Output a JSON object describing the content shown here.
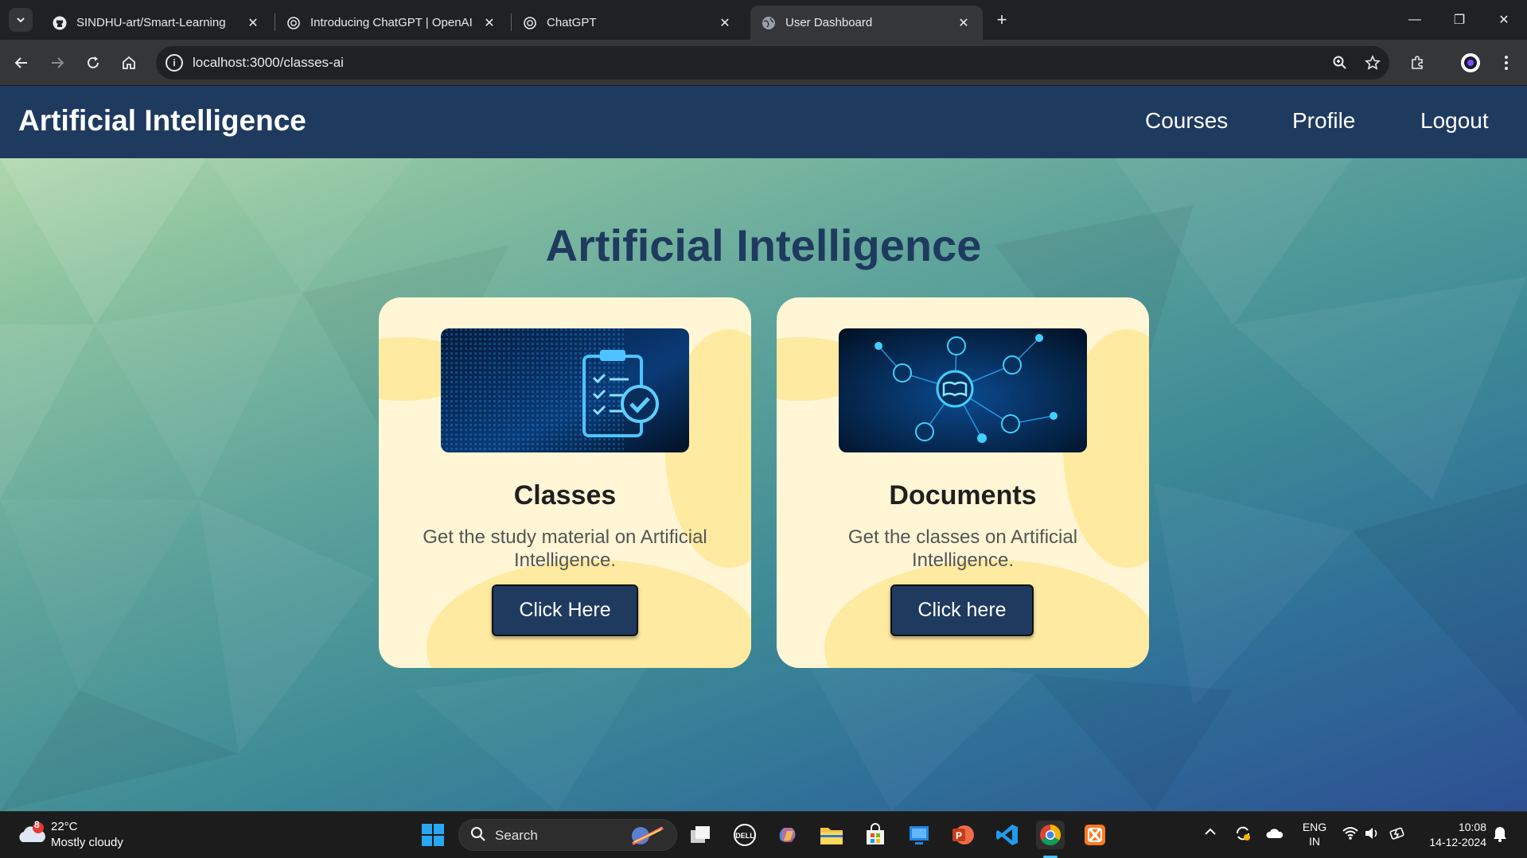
{
  "browser": {
    "tabs": [
      {
        "title": "SINDHU-art/Smart-Learning",
        "icon": "github-icon",
        "active": false
      },
      {
        "title": "Introducing ChatGPT | OpenAI",
        "icon": "openai-icon",
        "active": false
      },
      {
        "title": "ChatGPT",
        "icon": "openai-icon",
        "active": false
      },
      {
        "title": "User Dashboard",
        "icon": "globe-icon",
        "active": true
      }
    ],
    "url": "localhost:3000/classes-ai"
  },
  "app": {
    "brand": "Artificial Intelligence",
    "nav": {
      "courses": "Courses",
      "profile": "Profile",
      "logout": "Logout"
    },
    "heading": "Artificial Intelligence",
    "cards": [
      {
        "title": "Classes",
        "description": "Get the study material on Artificial Intelligence.",
        "button": "Click Here",
        "image": "clipboard-checklist-icon"
      },
      {
        "title": "Documents",
        "description": "Get the classes on Artificial Intelligence.",
        "button": "Click here",
        "image": "book-network-icon"
      }
    ],
    "colors": {
      "navbar": "#1f3a5f",
      "card": "#fff6d5",
      "button": "#1f3a5f"
    }
  },
  "taskbar": {
    "weather": {
      "temp": "22°C",
      "desc": "Mostly cloudy",
      "badge": "8"
    },
    "search": "Search",
    "lang": {
      "line1": "ENG",
      "line2": "IN"
    },
    "clock": {
      "time": "10:08",
      "date": "14-12-2024"
    }
  }
}
